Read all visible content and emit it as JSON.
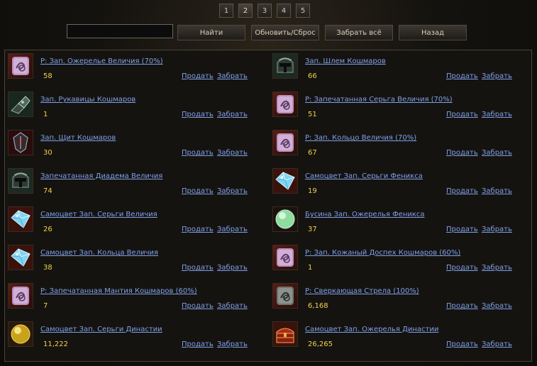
{
  "pagination": {
    "pages": [
      "1",
      "2",
      "3",
      "4",
      "5"
    ],
    "active": "2"
  },
  "toolbar": {
    "search_value": "",
    "find_label": "Найти",
    "refresh_label": "Обновить/Сброс",
    "take_all_label": "Забрать всё",
    "back_label": "Назад"
  },
  "items": [
    {
      "name": "Р: Зап. Ожерелье Величия (70%)",
      "count": "58",
      "icon": "scroll-recipe-icon",
      "sell": "Продать",
      "take": "Забрать"
    },
    {
      "name": "Зап. Шлем Кошмаров",
      "count": "66",
      "icon": "helmet-icon",
      "sell": "Продать",
      "take": "Забрать"
    },
    {
      "name": "Зап. Рукавицы Кошмаров",
      "count": "1",
      "icon": "gauntlets-icon",
      "sell": "Продать",
      "take": "Забрать"
    },
    {
      "name": "Р: Запечатанная Серьга Величия (70%)",
      "count": "51",
      "icon": "scroll-recipe-icon",
      "sell": "Продать",
      "take": "Забрать"
    },
    {
      "name": "Зап. Щит Кошмаров",
      "count": "30",
      "icon": "shield-icon",
      "sell": "Продать",
      "take": "Забрать"
    },
    {
      "name": "Р: Зап. Кольцо Величия (70%)",
      "count": "67",
      "icon": "scroll-recipe-icon",
      "sell": "Продать",
      "take": "Забрать"
    },
    {
      "name": "Запечатанная Диадема Величия",
      "count": "74",
      "icon": "helmet-icon",
      "sell": "Продать",
      "take": "Забрать"
    },
    {
      "name": "Самоцвет Зап. Серьги Феникса",
      "count": "19",
      "icon": "diamond-gem-icon",
      "sell": "Продать",
      "take": "Забрать"
    },
    {
      "name": "Самоцвет Зап. Серьги Величия",
      "count": "26",
      "icon": "diamond-gem-icon",
      "sell": "Продать",
      "take": "Забрать"
    },
    {
      "name": "Бусина Зап. Ожерелья Феникса",
      "count": "37",
      "icon": "green-bead-icon",
      "sell": "Продать",
      "take": "Забрать"
    },
    {
      "name": "Самоцвет Зап. Кольца Величия",
      "count": "38",
      "icon": "diamond-gem-icon",
      "sell": "Продать",
      "take": "Забрать"
    },
    {
      "name": "Р: Зап. Кожаный Доспех Кошмаров (60%)",
      "count": "1",
      "icon": "scroll-recipe-icon",
      "sell": "Продать",
      "take": "Забрать"
    },
    {
      "name": "Р: Запечатанная Мантия Кошмаров (60%)",
      "count": "7",
      "icon": "scroll-recipe-icon",
      "sell": "Продать",
      "take": "Забрать"
    },
    {
      "name": "Р: Сверкающая Стрела (100%)",
      "count": "6,168",
      "icon": "grey-scroll-icon",
      "sell": "Продать",
      "take": "Забрать"
    },
    {
      "name": "Самоцвет Зап. Серьги Династии",
      "count": "11,222",
      "icon": "gold-orb-icon",
      "sell": "Продать",
      "take": "Забрать"
    },
    {
      "name": "Самоцвет Зап. Ожерелья Династии",
      "count": "26,265",
      "icon": "treasure-chest-icon",
      "sell": "Продать",
      "take": "Забрать"
    }
  ]
}
